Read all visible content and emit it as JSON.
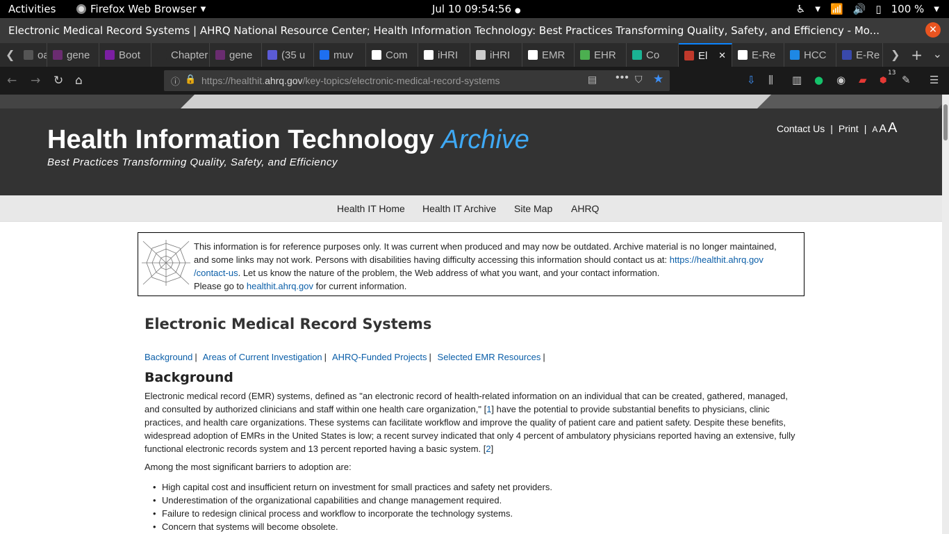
{
  "system_bar": {
    "activities": "Activities",
    "app_name": "Firefox Web Browser",
    "clock": "Jul 10  09:54:56",
    "battery": "100 %"
  },
  "window": {
    "title": "Electronic Medical Record Systems | AHRQ National Resource Center; Health Information Technology: Best Practices Transforming Quality, Safety, and Efficiency - Mo..."
  },
  "tabs": [
    {
      "label": "oar",
      "color": "#555555"
    },
    {
      "label": "gene",
      "color": "#6a2c70"
    },
    {
      "label": "Boot",
      "color": "#7b1fa2"
    },
    {
      "label": "Chapter",
      "color": "#2b2b2b"
    },
    {
      "label": "gene",
      "color": "#6a2c70"
    },
    {
      "label": "(35 u",
      "color": "#5b5bd6"
    },
    {
      "label": "muv",
      "color": "#1e6ff0"
    },
    {
      "label": "Com",
      "color": "#ffffff"
    },
    {
      "label": "iHRI",
      "color": "#ffffff"
    },
    {
      "label": "iHRI",
      "color": "#cccccc"
    },
    {
      "label": "EMR",
      "color": "#ffffff"
    },
    {
      "label": "EHR",
      "color": "#4caf50"
    },
    {
      "label": "Co",
      "color": "#1ab394"
    },
    {
      "label": "El",
      "color": "#c0392b",
      "active": true
    },
    {
      "label": "E-Re",
      "color": "#ffffff"
    },
    {
      "label": "HCC",
      "color": "#1e88e5"
    },
    {
      "label": "E-Re",
      "color": "#3949ab"
    }
  ],
  "urlbar": {
    "url_prefix": "https://healthit.",
    "url_domain": "ahrq.gov",
    "url_path": "/key-topics/electronic-medical-record-systems",
    "abp_badge": "13"
  },
  "header": {
    "title_main": "Health Information Technology",
    "title_archive": "Archive",
    "tagline": "Best Practices Transforming Quality, Safety, and Efficiency",
    "utility": {
      "contact": "Contact Us",
      "print": "Print",
      "text_sizes": [
        "A",
        "A",
        "A"
      ]
    }
  },
  "main_nav": [
    "Health IT Home",
    "Health IT Archive",
    "Site Map",
    "AHRQ"
  ],
  "notice": {
    "text1": "This information is for reference purposes only. It was current when produced and may now be outdated. Archive material is no longer maintained, and some links may not work. Persons with disabilities having difficulty accessing this information should contact us at: ",
    "contact_link": "https://healthit.ahrq.gov /contact-us",
    "text2": ". Let us know the nature of the problem, the Web address of what you want, and your contact information.",
    "text3": "Please go to ",
    "site_link": "healthit.ahrq.gov",
    "text4": " for current information."
  },
  "content": {
    "page_title": "Electronic Medical Record Systems",
    "jump_links": [
      "Background",
      "Areas of Current Investigation",
      "AHRQ-Funded Projects",
      "Selected EMR Resources"
    ],
    "jump_sep": "|",
    "background_heading": "Background",
    "para1_a": "Electronic medical record (EMR) systems, defined as \"an electronic record of health-related information on an individual that can be created, gathered, managed, and consulted by authorized clinicians and staff within one health care organization,\" [",
    "ref1": "1",
    "para1_b": "]  have the potential to provide substantial benefits to physicians, clinic practices, and health care organizations. These systems can facilitate workflow and improve the quality of patient care and patient safety. Despite these benefits, widespread adoption of EMRs in the United States is low; a recent survey indicated that only 4 percent of ambulatory physicians reported having an extensive, fully functional electronic records system and 13 percent reported having a basic system. [",
    "ref2": "2",
    "para1_c": "]",
    "para2": "Among the most significant barriers to adoption are:",
    "barriers": [
      "High capital cost and insufficient return on investment for small practices and safety net providers.",
      "Underestimation of the organizational capabilities and change management required.",
      "Failure to redesign clinical process and workflow to incorporate the technology systems.",
      "Concern that systems will become obsolete."
    ]
  }
}
